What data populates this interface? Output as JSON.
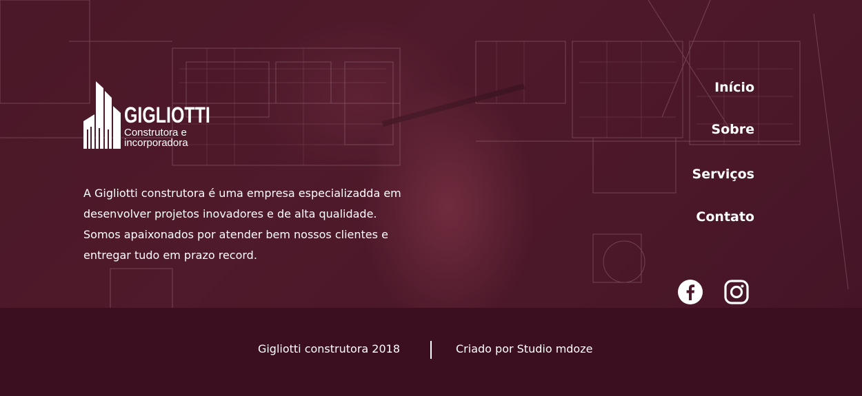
{
  "brand": {
    "name": "GIGLIOTTI",
    "tagline": "Construtora e incorporadora"
  },
  "about": {
    "text": "A Gigliotti construtora é uma empresa especializadda em desenvolver projetos inovadores e de alta qualidade. Somos apaixonados por atender bem nossos clientes e entregar tudo em prazo record."
  },
  "nav": {
    "items": [
      {
        "label": "Início"
      },
      {
        "label": "Sobre"
      },
      {
        "label": "Serviços"
      },
      {
        "label": "Contato"
      }
    ]
  },
  "social": {
    "facebook_icon": "facebook-icon",
    "instagram_icon": "instagram-icon"
  },
  "footer": {
    "copyright": "Gigliotti construtora 2018",
    "credit": "Criado por Studio mdoze"
  },
  "colors": {
    "hero_overlay": "#4b1829",
    "footer_bg": "#3b0f20",
    "text": "#ffffff"
  }
}
